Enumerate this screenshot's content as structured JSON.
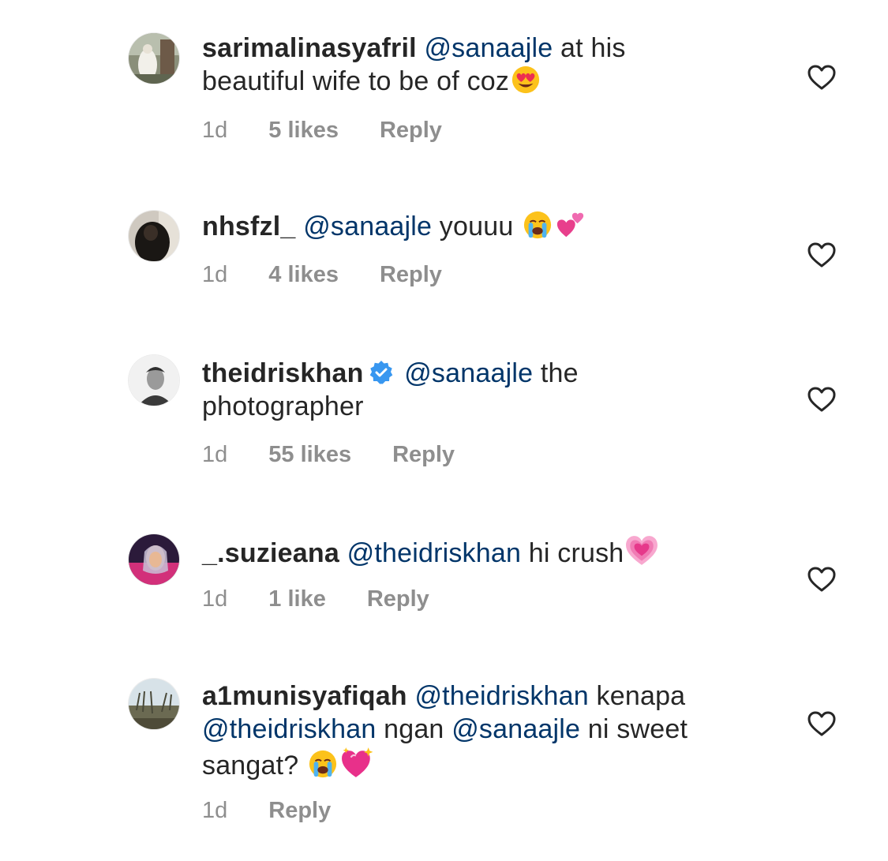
{
  "comments": [
    {
      "username": "sarimalinasyafril",
      "mention": "@sanaajle",
      "line1_text": " at his",
      "line2_text": "beautiful wife to be of coz",
      "emoji": "heart-eyes-emoji",
      "time": "1d",
      "likes": "5 likes",
      "reply": "Reply"
    },
    {
      "username": "nhsfzl_",
      "mention": "@sanaajle",
      "text": " youuu ",
      "emojis": [
        "crying-face-emoji",
        "two-hearts-emoji"
      ],
      "time": "1d",
      "likes": "4 likes",
      "reply": "Reply"
    },
    {
      "username": "theidriskhan",
      "verified_icon": "verified-badge-icon",
      "mention": "@sanaajle",
      "line1_text": " the",
      "line2_text": "photographer",
      "time": "1d",
      "likes": "55 likes",
      "reply": "Reply"
    },
    {
      "username": "_.suzieana",
      "mention": "@theidriskhan",
      "text": " hi crush",
      "emoji": "growing-heart-emoji",
      "time": "1d",
      "likes": "1 like",
      "reply": "Reply"
    },
    {
      "username": "a1munisyafiqah",
      "mention1": "@theidriskhan",
      "text1": " kenapa",
      "mention2": "@theidriskhan",
      "text2": " ngan ",
      "mention3": "@sanaajle",
      "text3": " ni sweet",
      "text4": "sangat? ",
      "emojis": [
        "crying-face-emoji",
        "sparkling-heart-emoji"
      ],
      "time": "1d",
      "reply": "Reply"
    }
  ],
  "colors": {
    "username": "#262626",
    "mention": "#003569",
    "meta": "#8e8e8e",
    "verified": "#3897f0"
  }
}
